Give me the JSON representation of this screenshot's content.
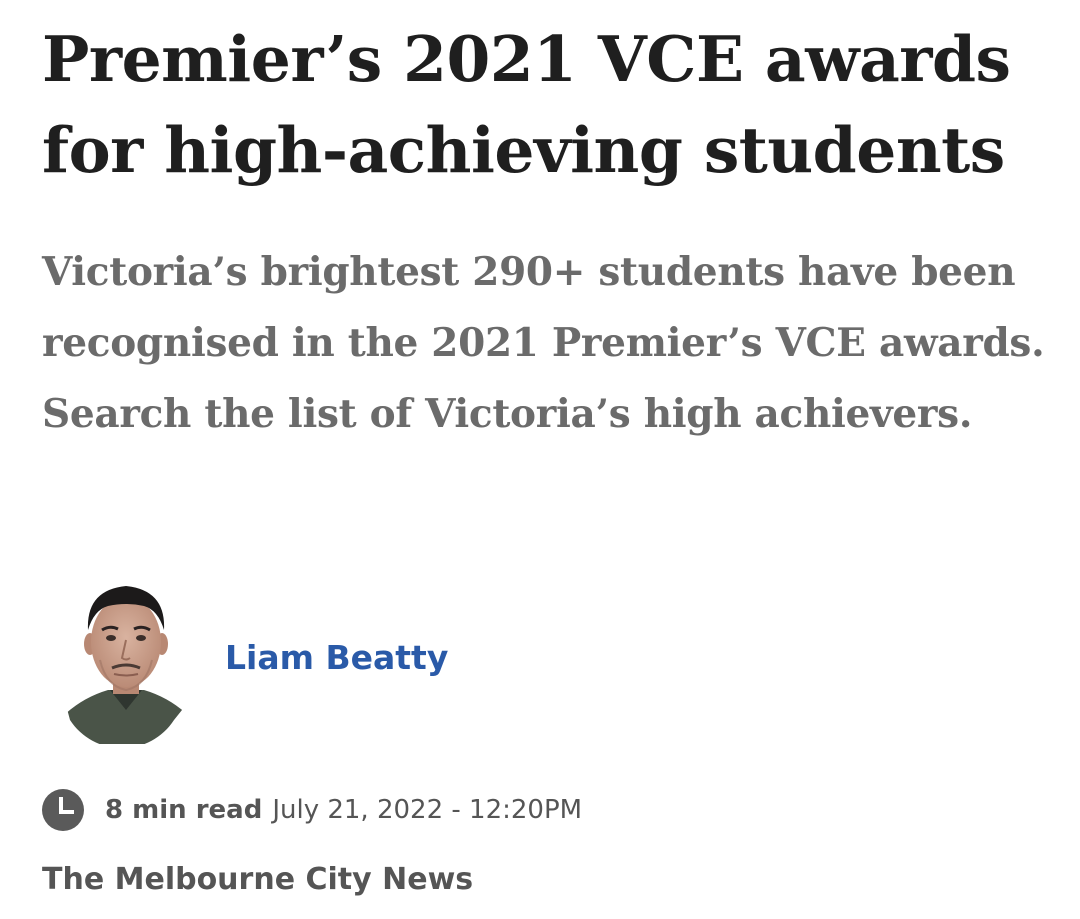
{
  "article": {
    "headline": "Premier’s 2021 VCE awards for high-achieving students",
    "standfirst": "Victoria’s brightest 290+ students have been recognised in the 2021 Premier’s VCE awards. Search the list of Victoria’s high achievers.",
    "author": {
      "name": "Liam Beatty",
      "avatar_icon": "author-photo"
    },
    "meta": {
      "clock_icon": "clock-icon",
      "read_time": "8 min read",
      "date": "July 21, 2022 - 12:20PM"
    },
    "publication": "The Melbourne City News"
  },
  "colors": {
    "headline": "#1f1f1f",
    "standfirst": "#6b6b6b",
    "author_link": "#2a5aa8",
    "meta_text": "#555555",
    "clock_icon": "#5a5a5a"
  }
}
